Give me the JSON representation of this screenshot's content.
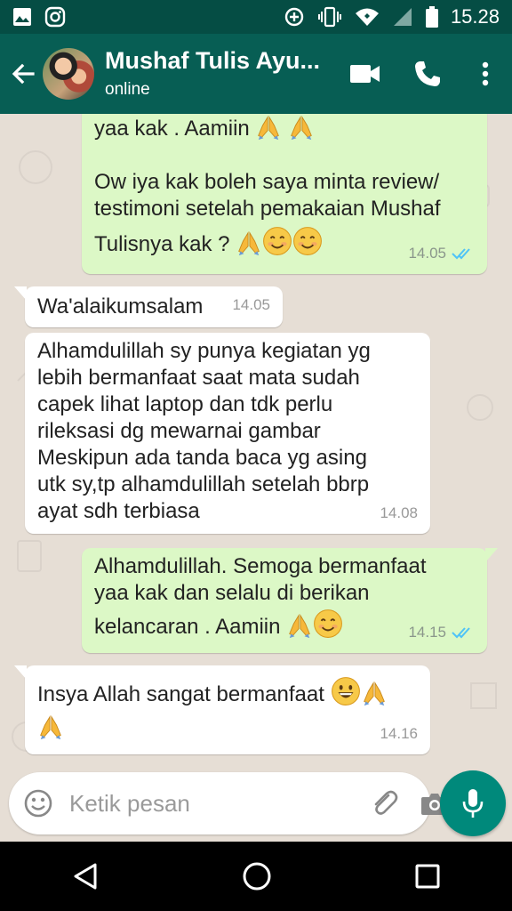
{
  "status_bar": {
    "time": "15.28"
  },
  "header": {
    "title": "Mushaf Tulis Ayu...",
    "subtitle": "online"
  },
  "messages": [
    {
      "dir": "out",
      "text_a": "yaa kak . Aamiin",
      "text_b": "Ow iya kak boleh saya minta review/",
      "text_c": "testimoni setelah pemakaian Mushaf",
      "text_d": "Tulisnya kak ?",
      "time": "14.05"
    },
    {
      "dir": "in",
      "text": "Wa'alaikumsalam",
      "time": "14.05"
    },
    {
      "dir": "in",
      "text": "Alhamdulillah sy punya kegiatan yg\nlebih bermanfaat saat mata sudah\ncapek lihat laptop dan tdk perlu\nrileksasi dg mewarnai gambar\nMeskipun ada tanda baca yg asing\nutk sy,tp alhamdulillah setelah bbrp\nayat sdh terbiasa",
      "time": "14.08"
    },
    {
      "dir": "out",
      "text_a": "Alhamdulillah. Semoga bermanfaat",
      "text_b": "yaa kak dan selalu di berikan",
      "text_c": "kelancaran . Aamiin",
      "time": "14.15"
    },
    {
      "dir": "in",
      "text": "Insya Allah sangat bermanfaat",
      "time": "14.16"
    }
  ],
  "input": {
    "placeholder": "Ketik pesan"
  },
  "colors": {
    "header": "#075e54",
    "status_bar": "#054d44",
    "outgoing": "#dcf8c6",
    "incoming": "#ffffff",
    "chat_bg": "#e6ded5",
    "accent": "#00897b",
    "read_ticks": "#4fc3f7"
  },
  "icons": [
    "gallery-icon",
    "instagram-icon",
    "data-saver-icon",
    "vibrate-icon",
    "wifi-icon",
    "signal-icon",
    "battery-icon",
    "back-arrow-icon",
    "video-call-icon",
    "phone-icon",
    "more-vert-icon",
    "emoji-icon",
    "attach-icon",
    "camera-icon",
    "mic-icon",
    "nav-back-icon",
    "nav-home-icon",
    "nav-recents-icon",
    "folded-hands-emoji",
    "smiling-face-emoji",
    "grinning-face-emoji",
    "double-check-icon"
  ]
}
